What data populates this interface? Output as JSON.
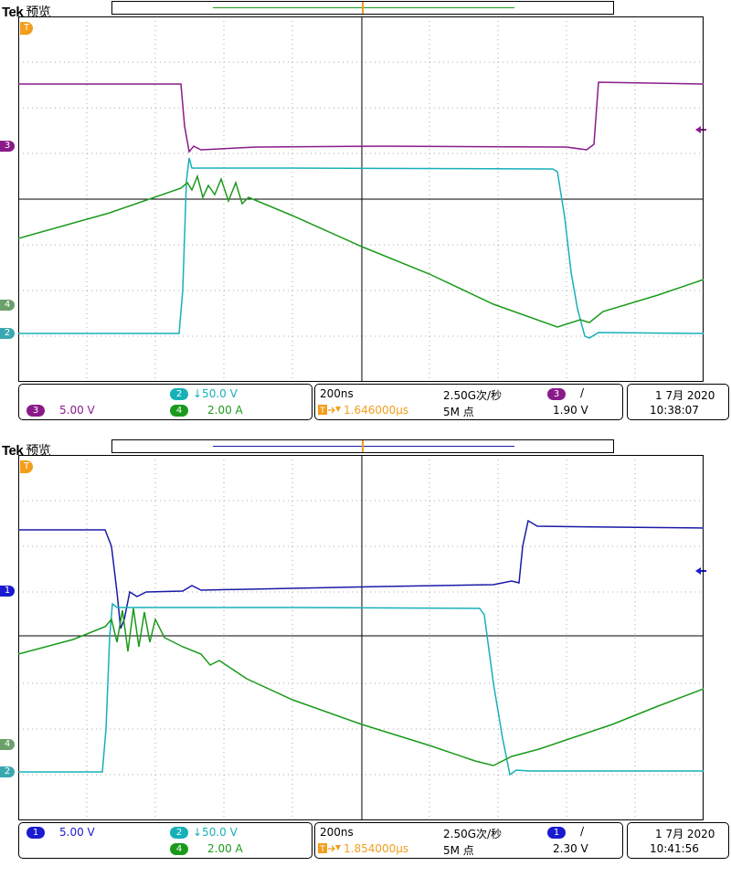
{
  "brand": {
    "name": "Tek",
    "mode": "预览"
  },
  "colors": {
    "ch1": "#1a1aa8",
    "ch2": "#17b0b8",
    "ch3": "#8a1a8a",
    "ch4": "#1a9a1a",
    "trigger": "#f29e1c",
    "grid": "#aaaaaa"
  },
  "screens": [
    {
      "id": "top",
      "trigger_marker_label": "T",
      "channel_indicators": [
        {
          "label": "3",
          "channel": "ch3"
        },
        {
          "label": "4",
          "channel": "ch4"
        },
        {
          "label": "2",
          "channel": "ch2"
        }
      ],
      "trigger_level_icon": "arrow-left-icon",
      "readouts": {
        "scale_a": {
          "channel_label": "3",
          "text": "5.00 V"
        },
        "scale_b": {
          "channel_label": "2",
          "text": "↓50.0 V"
        },
        "scale_c": {
          "channel_label": "4",
          "text": "2.00 A"
        },
        "timebase": "200ns",
        "sample_rate": "2.50G次/秒",
        "trigger_delay": "1.646000µs",
        "record_length": "5M 点",
        "trigger_channel": "3",
        "trigger_slope": "/",
        "trigger_level": "1.90 V",
        "date": "1 7月 2020",
        "time": "10:38:07"
      }
    },
    {
      "id": "bottom",
      "trigger_marker_label": "T",
      "channel_indicators": [
        {
          "label": "1",
          "channel": "ch1"
        },
        {
          "label": "4",
          "channel": "ch4"
        },
        {
          "label": "2",
          "channel": "ch2"
        }
      ],
      "trigger_level_icon": "arrow-left-icon",
      "readouts": {
        "scale_a": {
          "channel_label": "1",
          "text": "5.00 V"
        },
        "scale_b": {
          "channel_label": "2",
          "text": "↓50.0 V"
        },
        "scale_c": {
          "channel_label": "4",
          "text": "2.00 A"
        },
        "timebase": "200ns",
        "sample_rate": "2.50G次/秒",
        "trigger_delay": "1.854000µs",
        "record_length": "5M 点",
        "trigger_channel": "1",
        "trigger_slope": "/",
        "trigger_level": "2.30 V",
        "date": "1 7月 2020",
        "time": "10:41:56"
      }
    }
  ]
}
